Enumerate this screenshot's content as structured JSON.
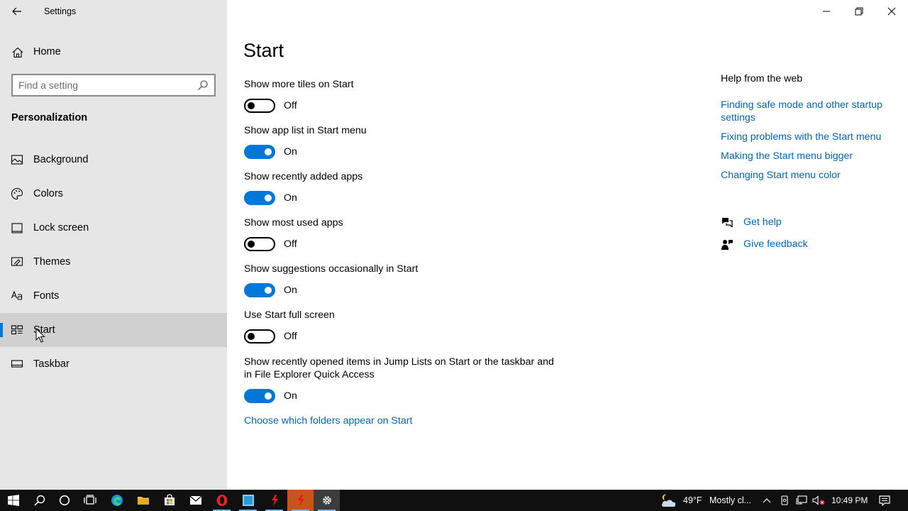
{
  "window": {
    "title": "Settings",
    "controls": [
      "minimize-icon",
      "restore-icon",
      "close-icon"
    ]
  },
  "sidebar": {
    "home_label": "Home",
    "search_placeholder": "Find a setting",
    "section_title": "Personalization",
    "items": [
      {
        "label": "Background",
        "icon": "image-icon"
      },
      {
        "label": "Colors",
        "icon": "palette-icon"
      },
      {
        "label": "Lock screen",
        "icon": "lock-screen-icon"
      },
      {
        "label": "Themes",
        "icon": "themes-icon"
      },
      {
        "label": "Fonts",
        "icon": "fonts-icon"
      },
      {
        "label": "Start",
        "icon": "start-tiles-icon",
        "selected": true
      },
      {
        "label": "Taskbar",
        "icon": "taskbar-icon"
      }
    ]
  },
  "main": {
    "title": "Start",
    "settings": [
      {
        "label": "Show more tiles on Start",
        "state": "Off"
      },
      {
        "label": "Show app list in Start menu",
        "state": "On"
      },
      {
        "label": "Show recently added apps",
        "state": "On"
      },
      {
        "label": "Show most used apps",
        "state": "Off"
      },
      {
        "label": "Show suggestions occasionally in Start",
        "state": "On"
      },
      {
        "label": "Use Start full screen",
        "state": "Off"
      },
      {
        "label": "Show recently opened items in Jump Lists on Start or the taskbar and in File Explorer Quick Access",
        "state": "On"
      }
    ],
    "folders_link": "Choose which folders appear on Start"
  },
  "help": {
    "title": "Help from the web",
    "links": [
      "Finding safe mode and other startup settings",
      "Fixing problems with the Start menu",
      "Making the Start menu bigger",
      "Changing Start menu color"
    ],
    "get_help": "Get help",
    "give_feedback": "Give feedback"
  },
  "taskbar": {
    "weather_temp": "49°F",
    "weather_text": "Mostly cl...",
    "time": "10:49 PM"
  },
  "colors": {
    "accent": "#0078d7",
    "link": "#0067b8",
    "sidebar_bg": "#e6e6e6",
    "taskbar_bg": "#101010"
  }
}
